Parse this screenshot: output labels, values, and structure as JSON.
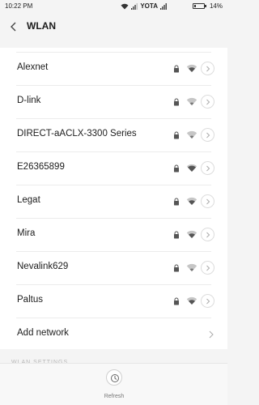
{
  "status_bar": {
    "time": "10:22 PM",
    "carrier": "YOTA",
    "battery": "14%",
    "icons": [
      "wifi-icon",
      "signal-icon",
      "signal-icon",
      "battery-icon"
    ]
  },
  "header": {
    "title": "WLAN",
    "back_icon": "chevron-left-icon"
  },
  "networks": [
    {
      "name": "Alexnet",
      "secured": true,
      "signal": "medium"
    },
    {
      "name": "D-link",
      "secured": true,
      "signal": "weak"
    },
    {
      "name": "DIRECT-aACLX-3300 Series",
      "secured": true,
      "signal": "weak"
    },
    {
      "name": "E26365899",
      "secured": true,
      "signal": "strong"
    },
    {
      "name": "Legat",
      "secured": true,
      "signal": "medium"
    },
    {
      "name": "Mira",
      "secured": true,
      "signal": "medium"
    },
    {
      "name": "Nevalink629",
      "secured": true,
      "signal": "weak"
    },
    {
      "name": "Paltus",
      "secured": true,
      "signal": "medium"
    }
  ],
  "add_network": {
    "label": "Add network"
  },
  "section_label": "WLAN SETTINGS",
  "bottom_bar": {
    "refresh_label": "Refresh"
  },
  "colors": {
    "background": "#f4f4f4",
    "panel": "#ffffff",
    "text": "#1d1d1d",
    "icon_strong": "#555555",
    "icon_weak": "#c6c6c6"
  }
}
